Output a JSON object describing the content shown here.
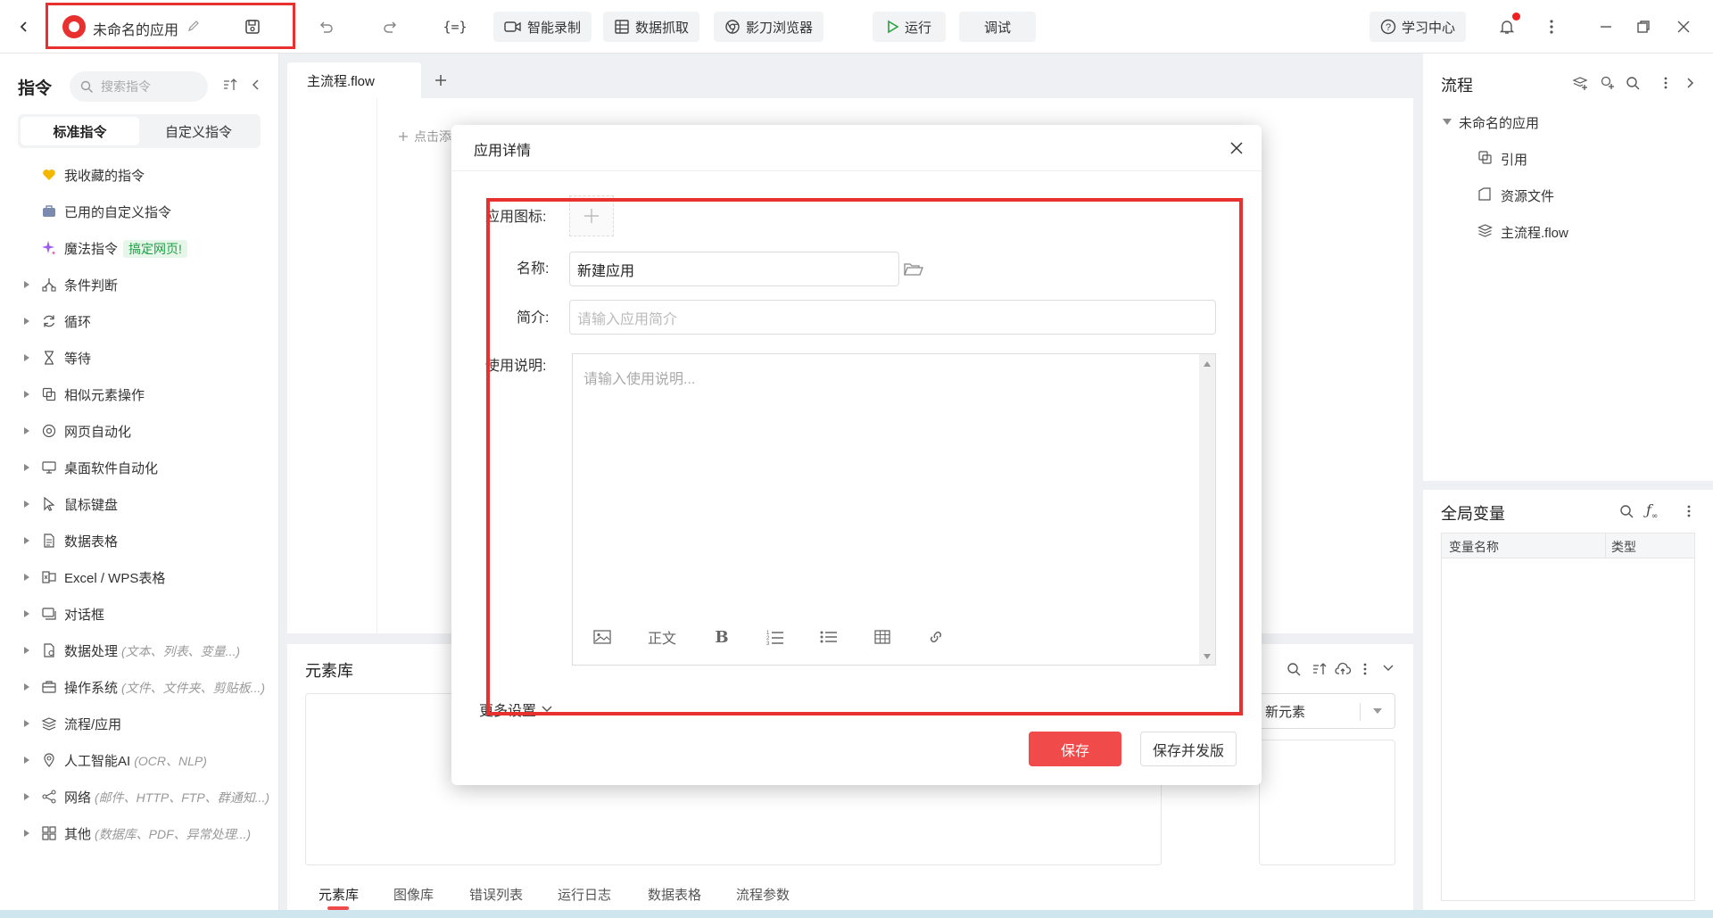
{
  "topbar": {
    "app_name": "未命名的应用",
    "record_label": "智能录制",
    "grab_label": "数据抓取",
    "browser_label": "影刀浏览器",
    "run_label": "运行",
    "debug_label": "调试",
    "learn_label": "学习中心"
  },
  "left": {
    "title": "指令",
    "search_placeholder": "搜索指令",
    "tab_standard": "标准指令",
    "tab_custom": "自定义指令",
    "items": [
      {
        "label": "我收藏的指令",
        "hint": "",
        "icon": "heart-icon"
      },
      {
        "label": "已用的自定义指令",
        "hint": "",
        "icon": "briefcase-icon"
      },
      {
        "label": "魔法指令",
        "hint": "",
        "icon": "sparkle-icon",
        "badge": "搞定网页!"
      },
      {
        "label": "条件判断",
        "hint": "",
        "icon": "branch-icon"
      },
      {
        "label": "循环",
        "hint": "",
        "icon": "loop-icon"
      },
      {
        "label": "等待",
        "hint": "",
        "icon": "hourglass-icon"
      },
      {
        "label": "相似元素操作",
        "hint": "",
        "icon": "copy-icon"
      },
      {
        "label": "网页自动化",
        "hint": "",
        "icon": "chrome-icon"
      },
      {
        "label": "桌面软件自动化",
        "hint": "",
        "icon": "monitor-icon"
      },
      {
        "label": "鼠标键盘",
        "hint": "",
        "icon": "cursor-icon"
      },
      {
        "label": "数据表格",
        "hint": "",
        "icon": "document-icon"
      },
      {
        "label": "Excel / WPS表格",
        "hint": "",
        "icon": "excel-icon"
      },
      {
        "label": "对话框",
        "hint": "",
        "icon": "dialog-icon"
      },
      {
        "label": "数据处理",
        "hint": "(文本、列表、变量...)",
        "icon": "data-icon"
      },
      {
        "label": "操作系统",
        "hint": "(文件、文件夹、剪贴板...)",
        "icon": "system-icon"
      },
      {
        "label": "流程/应用",
        "hint": "",
        "icon": "layers-icon"
      },
      {
        "label": "人工智能AI",
        "hint": "(OCR、NLP)",
        "icon": "ai-icon"
      },
      {
        "label": "网络",
        "hint": "(邮件、HTTP、FTP、群通知...)",
        "icon": "share-icon"
      },
      {
        "label": "其他",
        "hint": "(数据库、PDF、异常处理...)",
        "icon": "grid-icon"
      }
    ]
  },
  "center": {
    "tab_label": "主流程.flow",
    "canvas_hint": "点击添",
    "elemlib_title": "元素库",
    "new_element_label": "新元素",
    "bottom_tabs": [
      "元素库",
      "图像库",
      "错误列表",
      "运行日志",
      "数据表格",
      "流程参数"
    ]
  },
  "right": {
    "flow_title": "流程",
    "tree_root": "未命名的应用",
    "tree_items": [
      "引用",
      "资源文件",
      "主流程.flow"
    ],
    "vars_title": "全局变量",
    "col_name": "变量名称",
    "col_type": "类型"
  },
  "dialog": {
    "title": "应用详情",
    "icon_label": "应用图标:",
    "name_label": "名称:",
    "name_value": "新建应用",
    "intro_label": "简介:",
    "intro_placeholder": "请输入应用简介",
    "usage_label": "使用说明:",
    "usage_placeholder": "请输入使用说明...",
    "toolbar_text": "正文",
    "toolbar_bold": "B",
    "more_settings": "更多设置",
    "save_label": "保存",
    "save_publish_label": "保存并发版"
  },
  "colors": {
    "accent_red": "#f04a4a",
    "highlight_red": "#e8312f"
  }
}
